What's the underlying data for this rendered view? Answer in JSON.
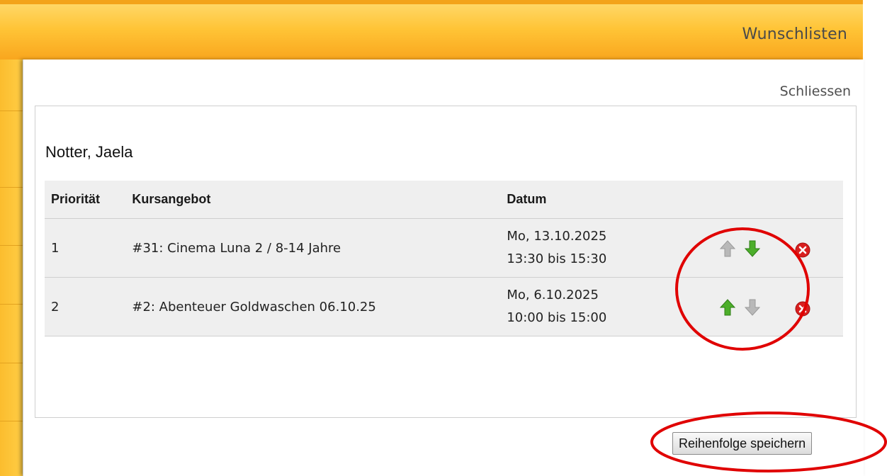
{
  "header": {
    "title": "Wunschlisten"
  },
  "modal": {
    "close_label": "Schliessen",
    "person_name": "Notter, Jaela",
    "table": {
      "headers": {
        "priority": "Priorität",
        "course": "Kursangebot",
        "date": "Datum"
      },
      "rows": [
        {
          "priority": "1",
          "course": "#31: Cinema Luna 2 / 8-14 Jahre",
          "date": "Mo, 13.10.2025",
          "time": "13:30 bis 15:30",
          "up_enabled": false,
          "down_enabled": true
        },
        {
          "priority": "2",
          "course": "#2: Abenteuer Goldwaschen 06.10.25",
          "date": "Mo, 6.10.2025",
          "time": "10:00 bis 15:00",
          "up_enabled": true,
          "down_enabled": false
        }
      ]
    },
    "save_label": "Reihenfolge speichern"
  },
  "colors": {
    "header_orange": "#f9a61e",
    "arrow_active": "#4cae2a",
    "arrow_disabled": "#b8b8b8",
    "remove_red": "#d81f1f",
    "annotation_red": "#e00000"
  },
  "icons": {
    "move_up": "arrow-up-icon",
    "move_down": "arrow-down-icon",
    "remove": "remove-icon"
  }
}
